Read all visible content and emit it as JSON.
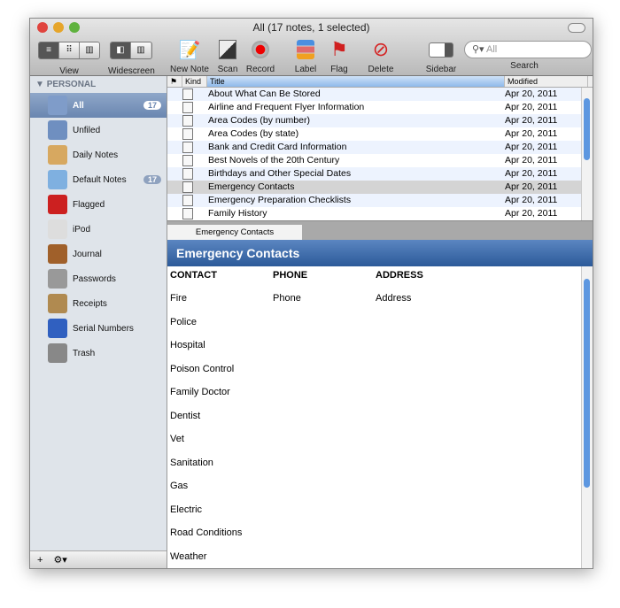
{
  "window": {
    "title": "All (17 notes, 1 selected)"
  },
  "toolbar": {
    "view": "View",
    "widescreen": "Widescreen",
    "new_note": "New Note",
    "scan": "Scan",
    "record": "Record",
    "label": "Label",
    "flag": "Flag",
    "delete": "Delete",
    "sidebar": "Sidebar",
    "search": "Search",
    "search_placeholder": "All"
  },
  "sidebar": {
    "header": "PERSONAL",
    "items": [
      {
        "label": "All",
        "badge": "17",
        "color": "#7f9cc9"
      },
      {
        "label": "Unfiled",
        "color": "#6f8fc0"
      },
      {
        "label": "Daily Notes",
        "color": "#d7a860"
      },
      {
        "label": "Default Notes",
        "badge": "17",
        "color": "#7fb0e0"
      },
      {
        "label": "Flagged",
        "color": "#cc2020"
      },
      {
        "label": "iPod",
        "color": "#dddddd"
      },
      {
        "label": "Journal",
        "color": "#a0602a"
      },
      {
        "label": "Passwords",
        "color": "#999999"
      },
      {
        "label": "Receipts",
        "color": "#b08a50"
      },
      {
        "label": "Serial Numbers",
        "color": "#3060c0"
      },
      {
        "label": "Trash",
        "color": "#888888"
      }
    ]
  },
  "list": {
    "columns": {
      "kind": "Kind",
      "title": "Title",
      "modified": "Modified"
    },
    "rows": [
      {
        "title": "About What Can Be Stored",
        "modified": "Apr 20, 2011"
      },
      {
        "title": "Airline and Frequent Flyer Information",
        "modified": "Apr 20, 2011"
      },
      {
        "title": "Area Codes (by number)",
        "modified": "Apr 20, 2011"
      },
      {
        "title": "Area Codes (by state)",
        "modified": "Apr 20, 2011"
      },
      {
        "title": "Bank and Credit Card Information",
        "modified": "Apr 20, 2011"
      },
      {
        "title": "Best Novels of the 20th Century",
        "modified": "Apr 20, 2011"
      },
      {
        "title": "Birthdays and Other Special Dates",
        "modified": "Apr 20, 2011"
      },
      {
        "title": "Emergency Contacts",
        "modified": "Apr 20, 2011",
        "selected": true
      },
      {
        "title": "Emergency Preparation Checklists",
        "modified": "Apr 20, 2011"
      },
      {
        "title": "Family History",
        "modified": "Apr 20, 2011"
      }
    ]
  },
  "note": {
    "tab": "Emergency Contacts",
    "title": "Emergency Contacts",
    "headers": [
      "CONTACT",
      "PHONE",
      "ADDRESS"
    ],
    "first_row": {
      "phone": "Phone",
      "address": "Address"
    },
    "contacts": [
      "Fire",
      "Police",
      "Hospital",
      "Poison Control",
      "Family Doctor",
      "Dentist",
      "Vet",
      "Sanitation",
      "Gas",
      "Electric",
      "Road Conditions",
      "Weather"
    ]
  }
}
